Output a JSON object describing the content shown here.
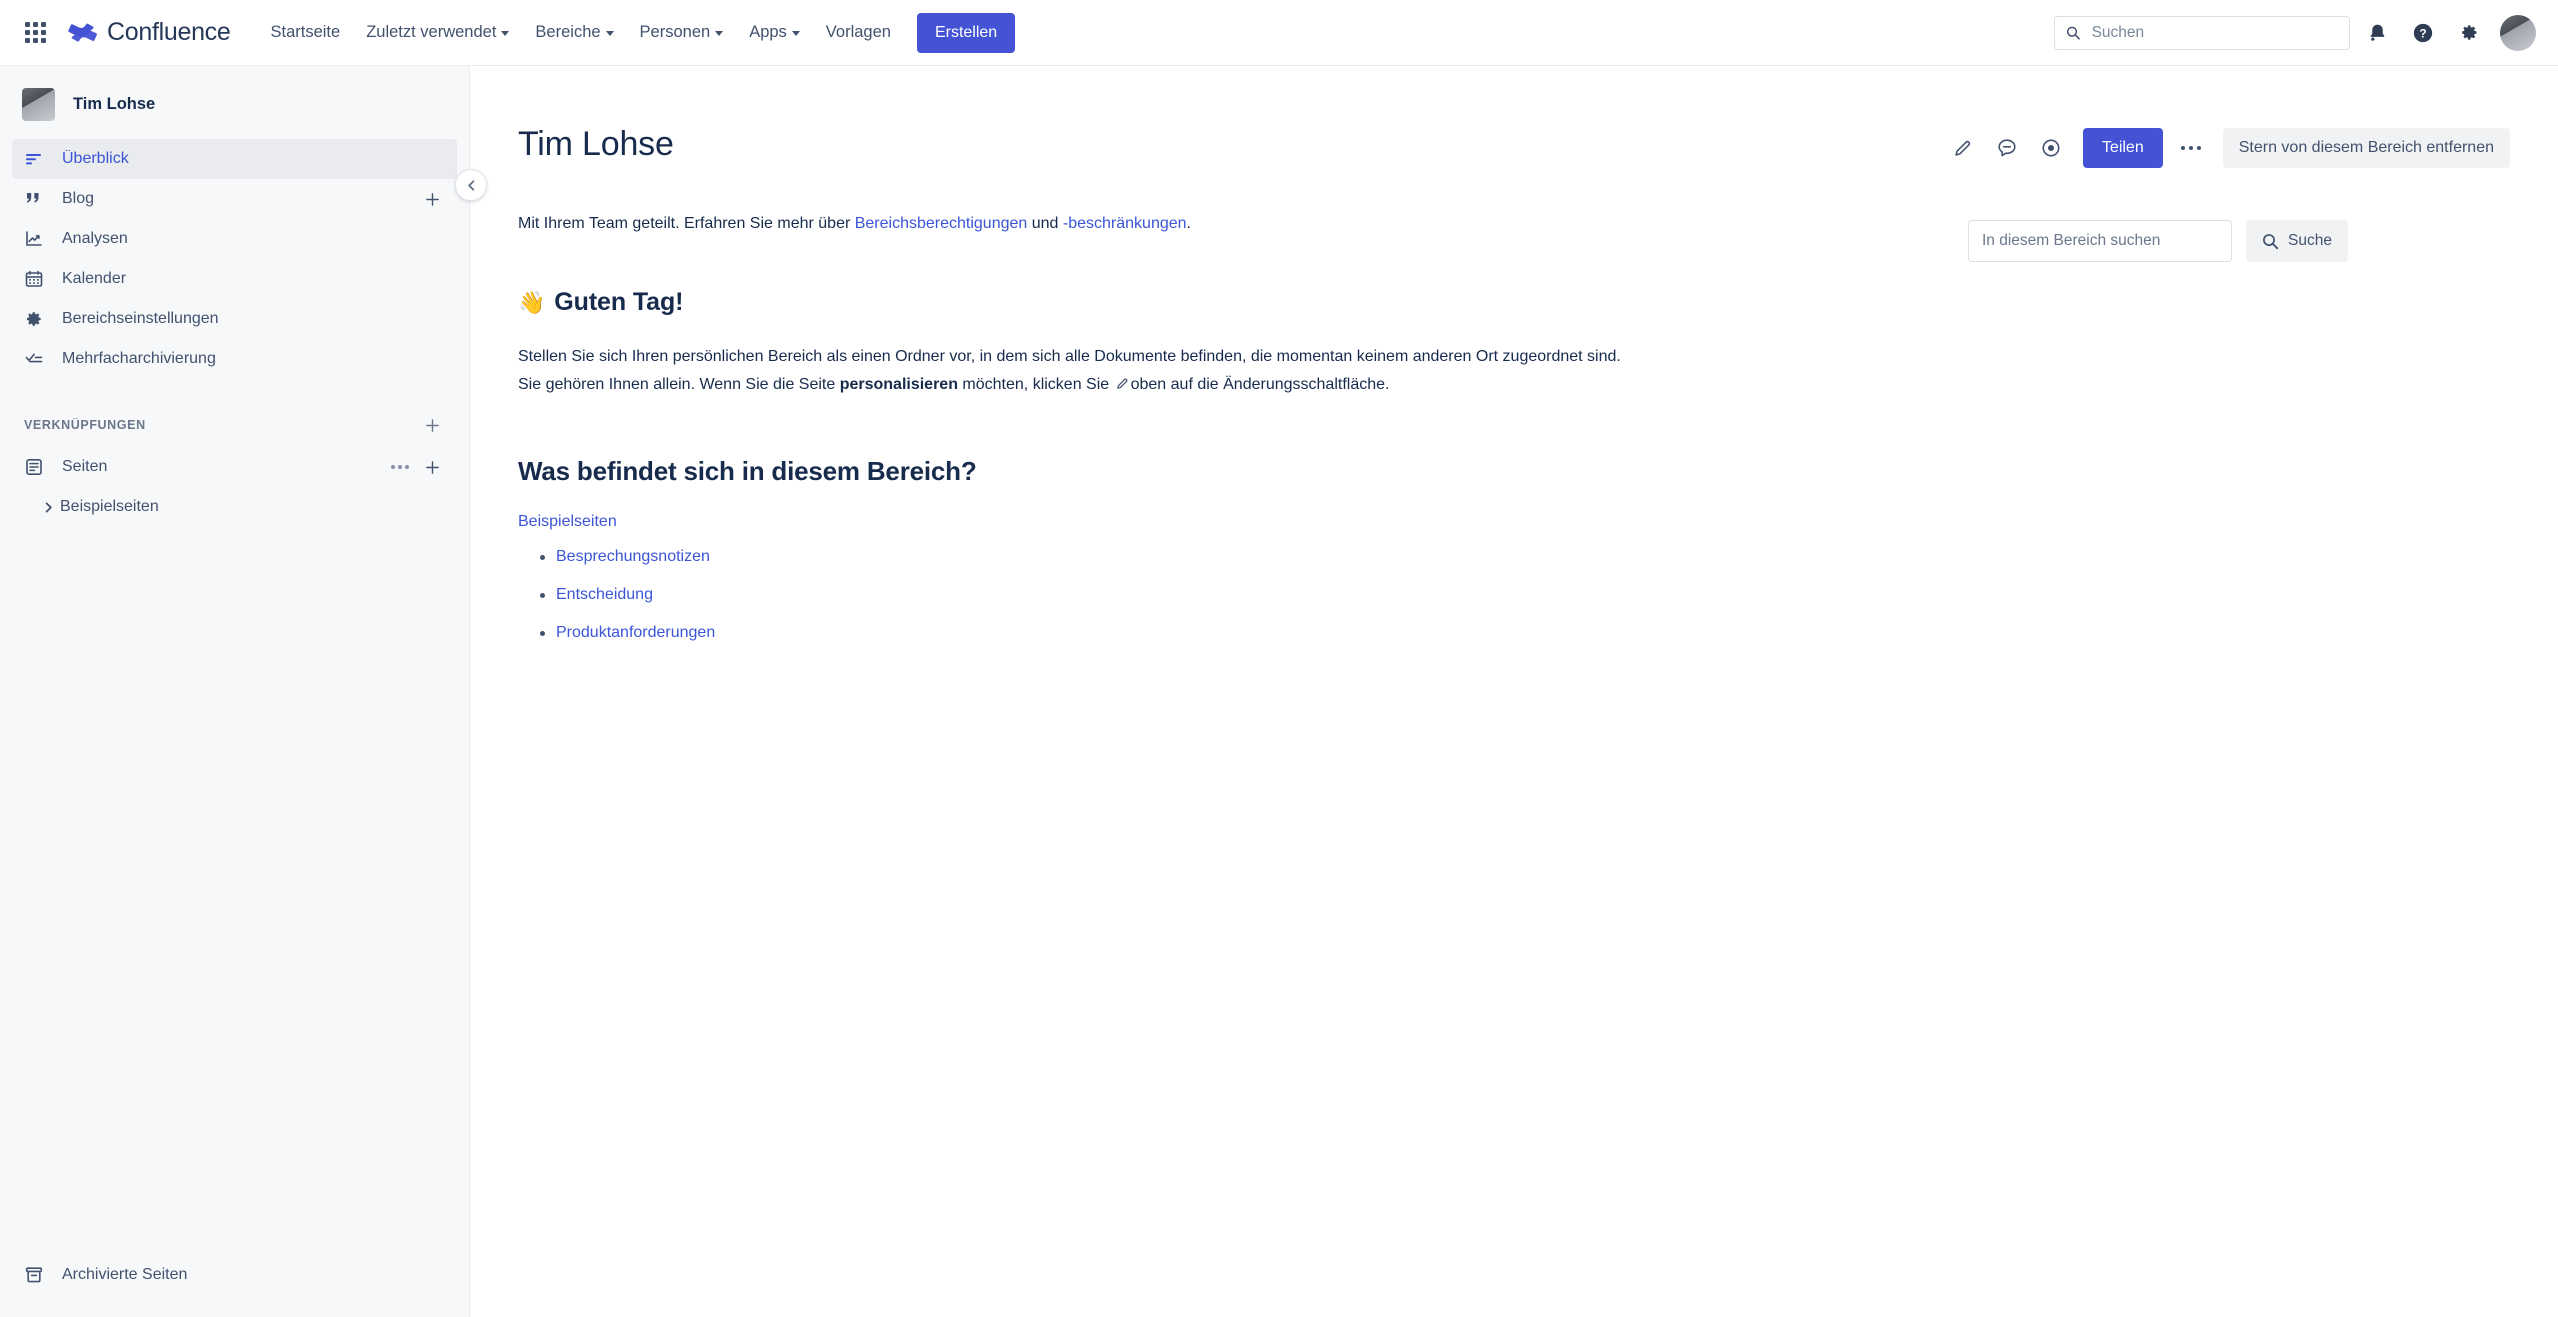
{
  "colors": {
    "brand_blue": "#4353d4",
    "link_blue": "#3b55d6",
    "text_dark": "#172b4d",
    "text_subtle": "#42526e",
    "sidebar_bg": "#f7f8f9",
    "neutral_btn": "#f1f2f4"
  },
  "topnav": {
    "app_switcher_icon": "grid-apps-icon",
    "brand_logo_icon": "confluence-logo-icon",
    "brand_name": "Confluence",
    "items": [
      {
        "label": "Startseite",
        "has_caret": false
      },
      {
        "label": "Zuletzt verwendet",
        "has_caret": true
      },
      {
        "label": "Bereiche",
        "has_caret": true
      },
      {
        "label": "Personen",
        "has_caret": true
      },
      {
        "label": "Apps",
        "has_caret": true
      },
      {
        "label": "Vorlagen",
        "has_caret": false
      }
    ],
    "create_label": "Erstellen",
    "search": {
      "placeholder": "Suchen",
      "value": "",
      "icon": "search-icon"
    },
    "right_icons": [
      {
        "name": "notifications-bell-icon"
      },
      {
        "name": "help-question-icon"
      },
      {
        "name": "settings-gear-icon"
      }
    ],
    "avatar_name": "user-avatar"
  },
  "sidebar": {
    "space_name": "Tim Lohse",
    "space_avatar": "space-avatar",
    "collapse_icon": "chevron-left-icon",
    "items": [
      {
        "label": "Überblick",
        "icon": "overview-lines-icon",
        "active": true,
        "plus": false
      },
      {
        "label": "Blog",
        "icon": "quote-marks-icon",
        "active": false,
        "plus": true
      },
      {
        "label": "Analysen",
        "icon": "analytics-chart-icon",
        "active": false,
        "plus": false
      },
      {
        "label": "Kalender",
        "icon": "calendar-icon",
        "active": false,
        "plus": false
      },
      {
        "label": "Bereichseinstellungen",
        "icon": "gear-icon",
        "active": false,
        "plus": false
      },
      {
        "label": "Mehrfacharchivierung",
        "icon": "bulk-archive-check-icon",
        "active": false,
        "plus": false
      }
    ],
    "section_label": "VERKNÜPFUNGEN",
    "section_plus": "add-shortcut-icon",
    "pages": {
      "label": "Seiten",
      "icon": "page-tree-icon",
      "dots": "more-actions-icon",
      "plus": "add-page-icon"
    },
    "tree": [
      {
        "label": "Beispielseiten",
        "chevron": "chevron-right-icon"
      }
    ],
    "footer": {
      "label": "Archivierte Seiten",
      "icon": "archive-box-icon"
    }
  },
  "page": {
    "title": "Tim Lohse",
    "actions": {
      "edit_icon": "pencil-edit-icon",
      "comment_icon": "comment-bubble-icon",
      "watch_icon": "watch-eye-icon",
      "share_label": "Teilen",
      "more_icon": "more-ellipsis-icon",
      "star_label": "Stern von diesem Bereich entfernen"
    },
    "share_notice": {
      "prefix": "Mit Ihrem Team geteilt. Erfahren Sie mehr über ",
      "link1": "Bereichsberechtigungen",
      "middle": " und ",
      "link2": "-beschränkungen",
      "suffix": "."
    },
    "greeting": {
      "emoji": "👋",
      "emoji_name": "waving-hand-emoji",
      "text": "Guten Tag!"
    },
    "intro": {
      "part1": "Stellen Sie sich Ihren persönlichen Bereich als einen Ordner vor, in dem sich alle Dokumente befinden, die momentan keinem anderen Ort zugeordnet sind. Sie gehören Ihnen allein. Wenn Sie die Seite ",
      "bold": "personalisieren",
      "part2": " möchten, klicken Sie ",
      "part3": "oben auf die Änderungsschaltfläche."
    },
    "section_title": "Was befindet sich in diesem Bereich?",
    "example_link": "Beispielseiten",
    "page_links": [
      "Besprechungsnotizen",
      "Entscheidung",
      "Produktanforderungen"
    ],
    "space_search": {
      "placeholder": "In diesem Bereich suchen",
      "value": "",
      "button_label": "Suche",
      "button_icon": "search-icon"
    }
  }
}
